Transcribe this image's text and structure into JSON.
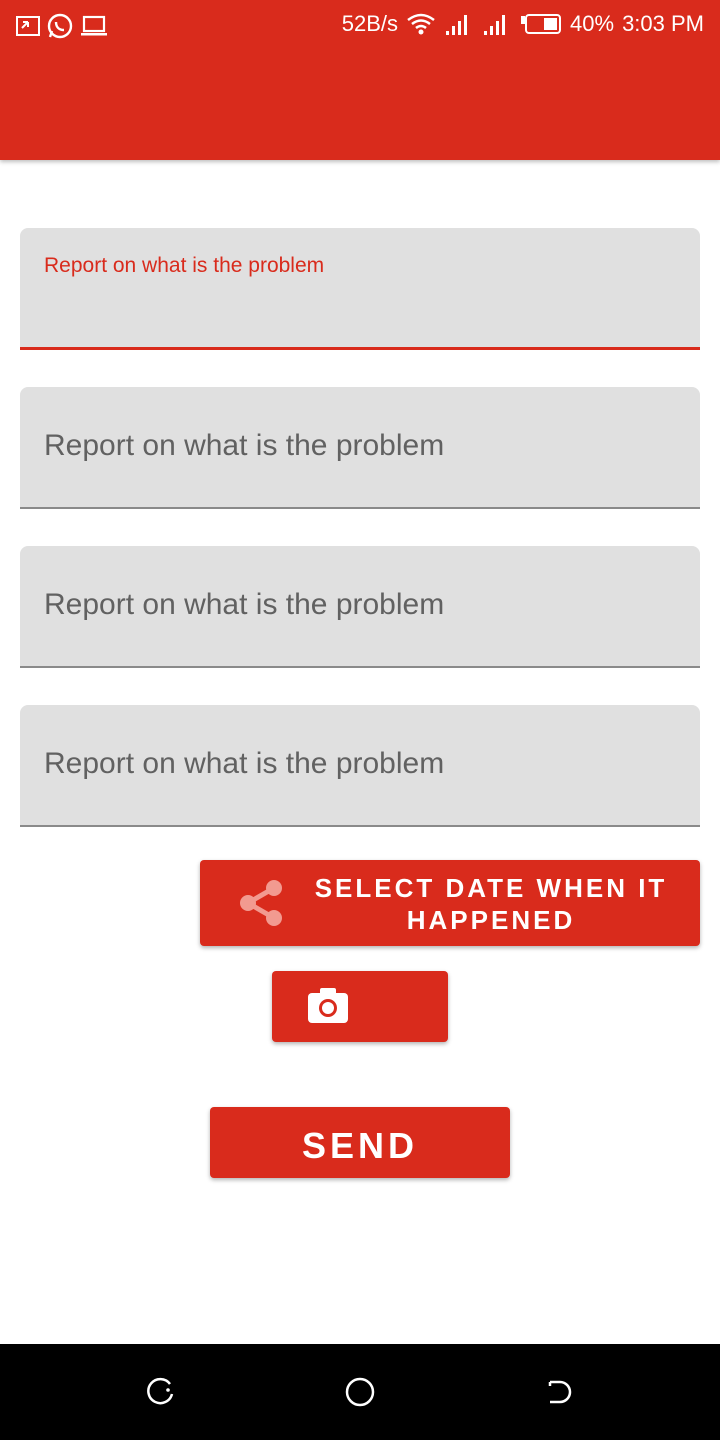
{
  "status_bar": {
    "net_speed": "52B/s",
    "battery": "40%",
    "time": "3:03 PM",
    "left_icons": [
      "cast-icon",
      "whatsapp-icon",
      "laptop-icon"
    ]
  },
  "form": {
    "fields": [
      {
        "label": "Report on what is the problem",
        "state": "focused"
      },
      {
        "placeholder": "Report on what is the problem"
      },
      {
        "placeholder": "Report on what is the problem"
      },
      {
        "placeholder": "Report on what is the problem"
      }
    ],
    "select_date_label": "SELECT DATE WHEN IT HAPPENED",
    "send_label": "SEND"
  },
  "colors": {
    "primary": "#d92b1c",
    "field_bg": "#e0e0e0",
    "placeholder": "#616161"
  },
  "nav_bar": {
    "items": [
      "recent-apps-icon",
      "home-icon",
      "back-icon"
    ]
  }
}
